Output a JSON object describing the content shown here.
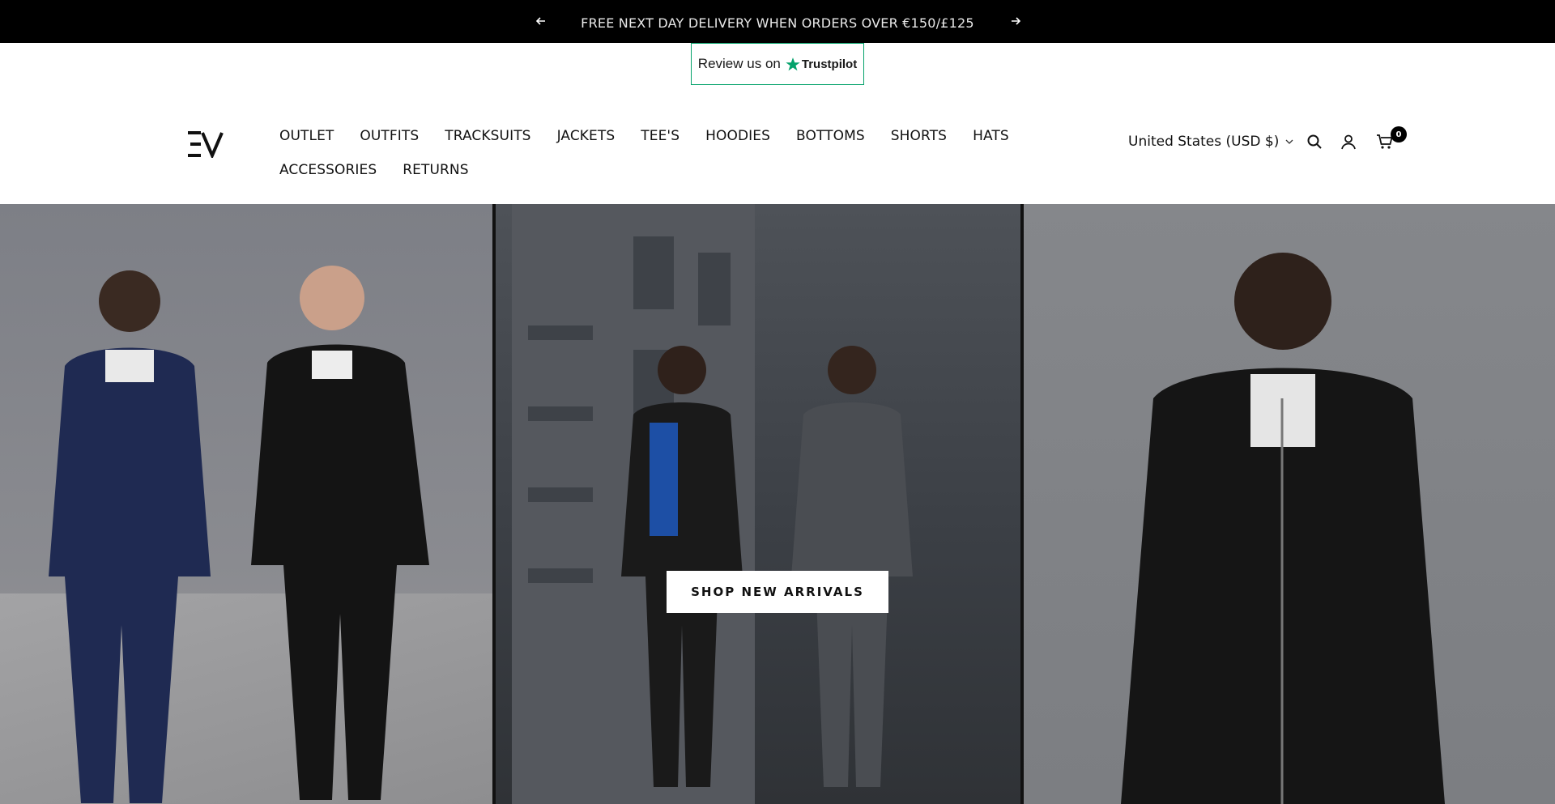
{
  "announcement": {
    "text": "FREE NEXT DAY DELIVERY WHEN ORDERS OVER €150/£125",
    "prev_icon": "arrow-left-icon",
    "next_icon": "arrow-right-icon"
  },
  "trustpilot": {
    "review_text": "Review us on",
    "brand": "Trustpilot",
    "accent": "#04a26b"
  },
  "header": {
    "logo_icon": "ev-logo",
    "nav": [
      "OUTLET",
      "OUTFITS",
      "TRACKSUITS",
      "JACKETS",
      "TEE'S",
      "HOODIES",
      "BOTTOMS",
      "SHORTS",
      "HATS",
      "ACCESSORIES",
      "RETURNS"
    ],
    "country": "United States (USD $)",
    "cart_count": "0",
    "icons": [
      "search-icon",
      "account-icon",
      "cart-icon"
    ]
  },
  "hero": {
    "cta_label": "SHOP NEW ARRIVALS"
  }
}
